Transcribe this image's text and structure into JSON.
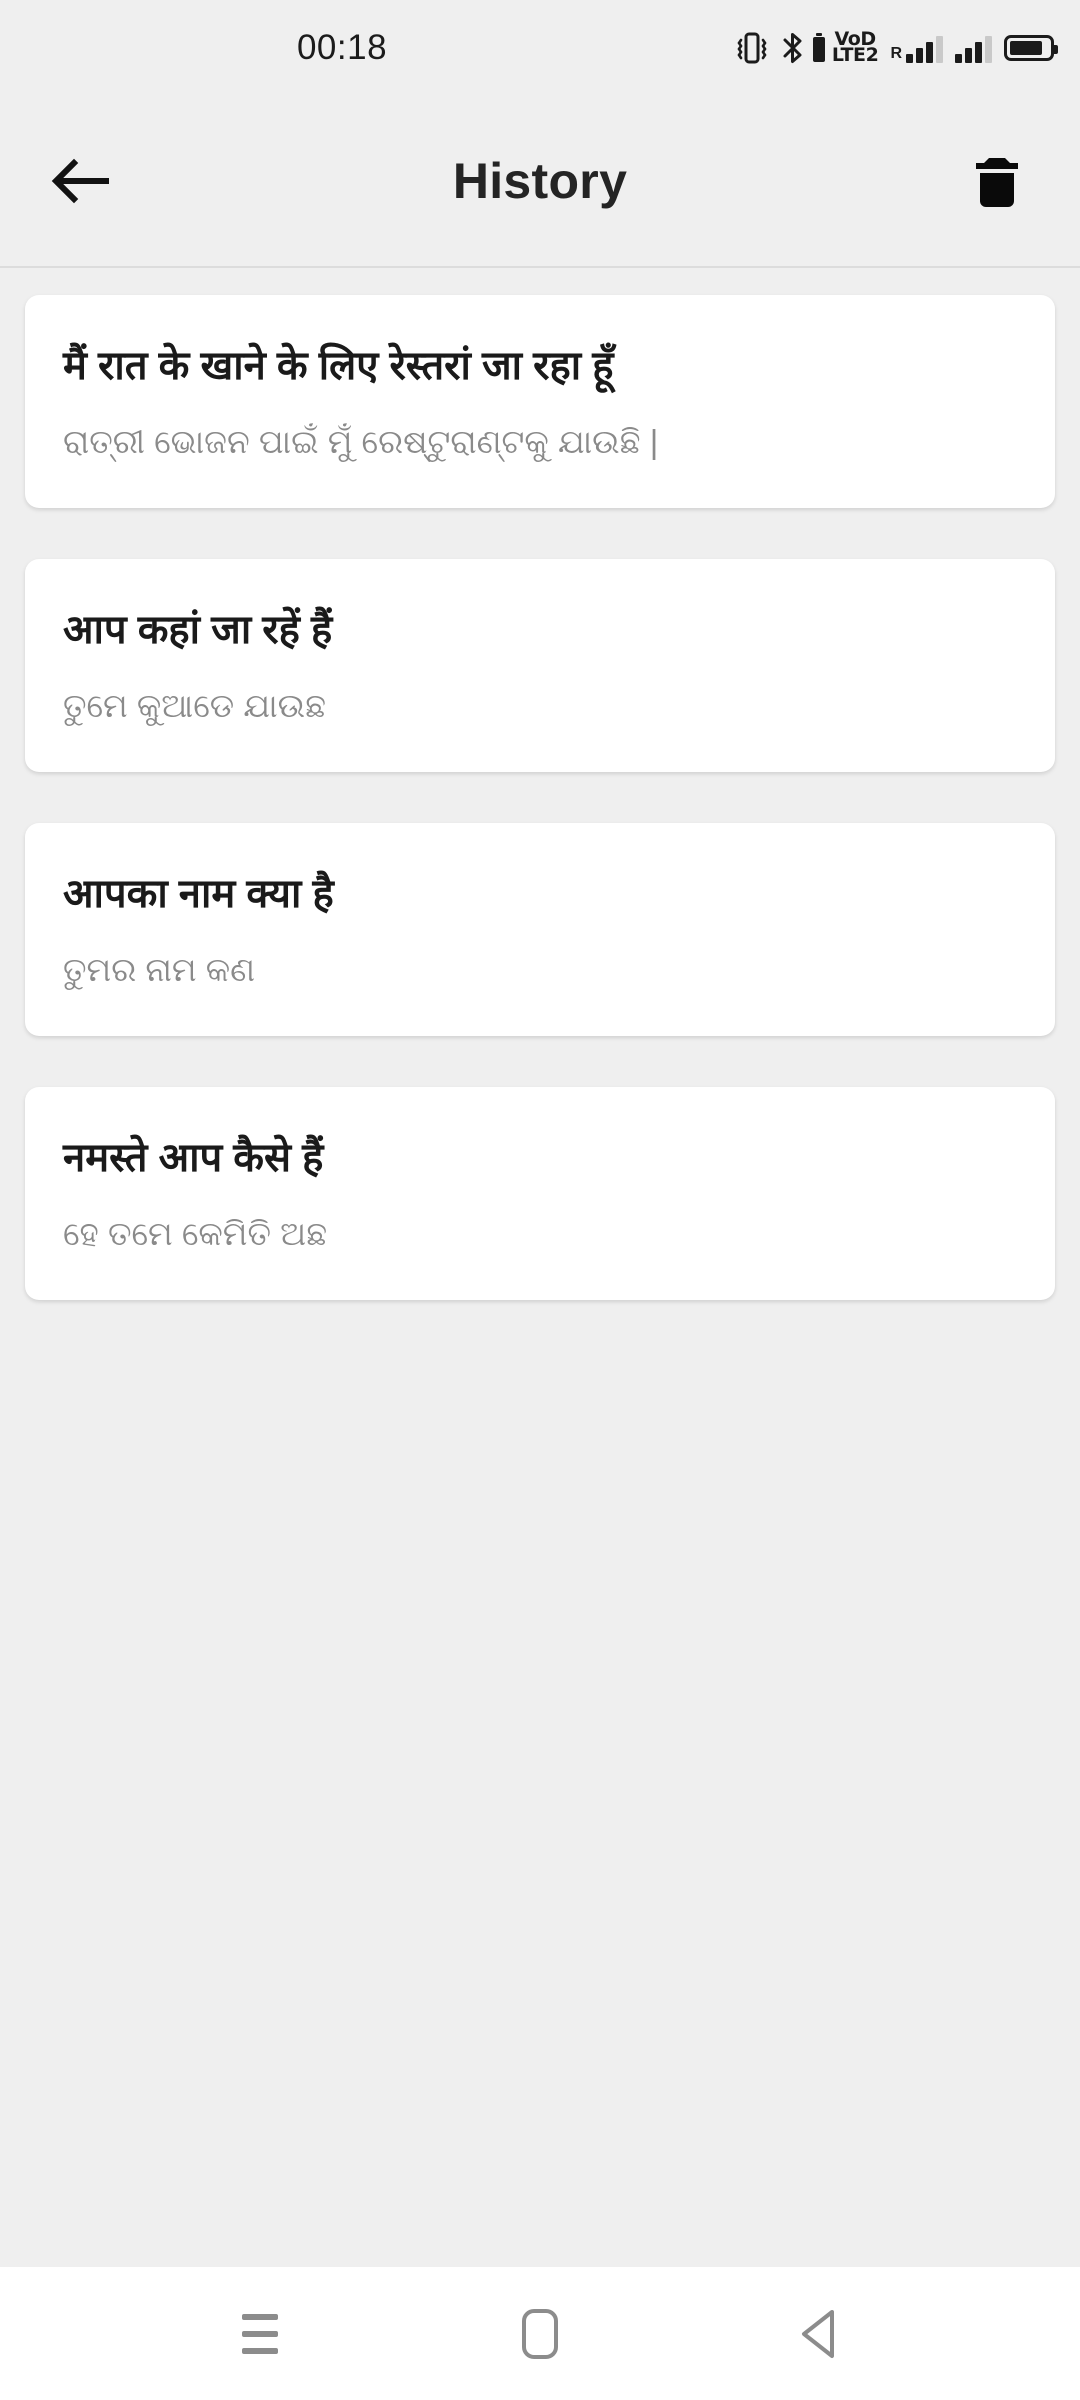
{
  "status_bar": {
    "clock": "00:18",
    "icons": [
      "vibrate-icon",
      "bluetooth-icon",
      "bluetooth-battery-icon",
      "volte-icon",
      "signal-roaming-icon",
      "signal-icon",
      "battery-icon"
    ],
    "volte_top": "VoD",
    "volte_bottom": "LTE2",
    "roaming_label": "R"
  },
  "app_bar": {
    "title": "History",
    "back_icon": "arrow-left-icon",
    "delete_icon": "trash-icon"
  },
  "history": {
    "items": [
      {
        "source": "मैं रात के खाने के लिए रेस्तरां जा रहा हूँ",
        "target": "ରାତ୍ରୀ ଭୋଜନ ପାଇଁ ମୁଁ ରେଷ୍ଟୁରାଣ୍ଟକୁ ଯାଉଛି |"
      },
      {
        "source": "आप कहां जा रहें हैं",
        "target": "ତୁମେ କୁଆଡେ ଯାଉଛ"
      },
      {
        "source": "आपका नाम क्या है",
        "target": "ତୁମର ନାମ କଣ"
      },
      {
        "source": "नमस्ते आप कैसे हैं",
        "target": "ହେ ତମେ କେମିତି ଅଛ"
      }
    ]
  },
  "nav_bar": {
    "recents_icon": "recents-icon",
    "home_icon": "home-icon",
    "back_icon": "back-triangle-icon"
  },
  "colors": {
    "background": "#efefef",
    "card": "#ffffff",
    "primary_text": "#1a1a1a",
    "secondary_text": "#8a8a8a",
    "nav_icon": "#8c8c8c"
  }
}
